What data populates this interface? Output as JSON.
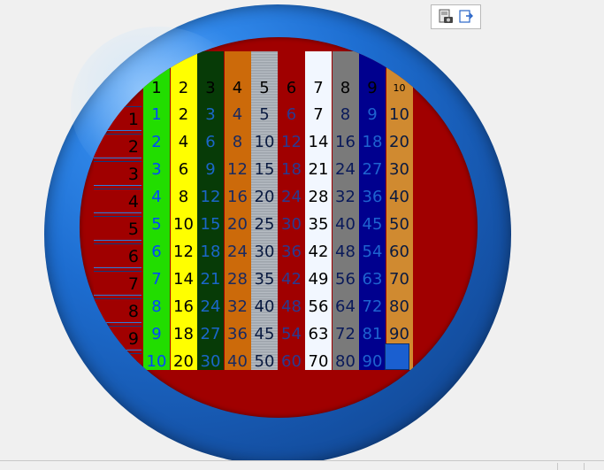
{
  "toolbar": {
    "buttons": [
      {
        "icon": "screenshot-camera-icon"
      },
      {
        "icon": "export-window-icon"
      }
    ]
  },
  "grid": {
    "row_labels": [
      "1",
      "2",
      "3",
      "4",
      "5",
      "6",
      "7",
      "8",
      "9",
      "10"
    ],
    "columns": [
      {
        "bg": "#22dd00",
        "color": "#0047ff",
        "header": "1",
        "values": [
          "1",
          "2",
          "3",
          "4",
          "5",
          "6",
          "7",
          "8",
          "9",
          "10"
        ]
      },
      {
        "bg": "#ffff00",
        "color": "#000000",
        "header": "2",
        "values": [
          "2",
          "4",
          "6",
          "8",
          "10",
          "12",
          "14",
          "16",
          "18",
          "20"
        ]
      },
      {
        "bg": "#073b07",
        "color": "#1b67c8",
        "header": "3",
        "values": [
          "3",
          "6",
          "9",
          "12",
          "15",
          "18",
          "21",
          "24",
          "27",
          "30"
        ]
      },
      {
        "bg": "#cc6a0a",
        "color": "#1a2a60",
        "header": "4",
        "values": [
          "4",
          "8",
          "12",
          "16",
          "20",
          "24",
          "28",
          "32",
          "36",
          "40"
        ]
      },
      {
        "bg": "silver",
        "color": "#0a1a40",
        "header": "5",
        "values": [
          "5",
          "10",
          "15",
          "20",
          "25",
          "30",
          "35",
          "40",
          "45",
          "50"
        ]
      },
      {
        "bg": "#a00000",
        "color": "#2a3a90",
        "header": "6",
        "values": [
          "6",
          "12",
          "18",
          "24",
          "30",
          "36",
          "42",
          "48",
          "54",
          "60"
        ]
      },
      {
        "bg": "#f2f7ff",
        "color": "#000000",
        "header": "7",
        "values": [
          "7",
          "14",
          "21",
          "28",
          "35",
          "42",
          "49",
          "56",
          "63",
          "70"
        ]
      },
      {
        "bg": "#7a7a7a",
        "color": "#0a1a5a",
        "header": "8",
        "values": [
          "8",
          "16",
          "24",
          "32",
          "40",
          "48",
          "56",
          "64",
          "72",
          "80"
        ]
      },
      {
        "bg": "#00008e",
        "color": "#1e63d0",
        "header": "9",
        "values": [
          "9",
          "18",
          "27",
          "36",
          "45",
          "54",
          "63",
          "72",
          "81",
          "90"
        ]
      },
      {
        "bg": "#d08a30",
        "color": "#0a1a40",
        "header": "10",
        "values": [
          "10",
          "20",
          "30",
          "40",
          "50",
          "60",
          "70",
          "80",
          "90",
          ""
        ]
      }
    ]
  }
}
